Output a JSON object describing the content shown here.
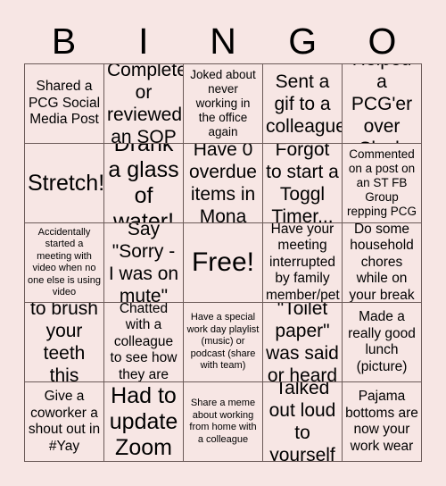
{
  "card": {
    "title": "BINGO",
    "background_color": "#f7e6e4",
    "border_color": "#6b5a58",
    "text_color": "#000000",
    "header_letters": [
      "B",
      "I",
      "N",
      "G",
      "O"
    ],
    "columns": 5,
    "rows": 5,
    "cells": [
      {
        "text": "Shared a PCG Social Media Post",
        "size": "s-md"
      },
      {
        "text": "Completed or reviewed an SOP",
        "size": "s-lg"
      },
      {
        "text": "Joked about never working in the office again",
        "size": "s-sm"
      },
      {
        "text": "Sent a gif to a colleague",
        "size": "s-lg"
      },
      {
        "text": "Helped a PCG'er over Slack",
        "size": "s-lg"
      },
      {
        "text": "Stretch!",
        "size": "s-xl"
      },
      {
        "text": "Drank a glass of water!",
        "size": "s-xl"
      },
      {
        "text": "Have 0 overdue items in Mona",
        "size": "s-lg"
      },
      {
        "text": "Forgot to start a Toggl Timer...",
        "size": "s-lg"
      },
      {
        "text": "Commented on a post on an ST FB Group repping PCG",
        "size": "s-sm"
      },
      {
        "text": "Accidentally started a meeting with video when no one else is using video",
        "size": "s-xs"
      },
      {
        "text": "Say \"Sorry - I was on mute\"",
        "size": "s-lg"
      },
      {
        "text": "Free!",
        "size": "s-free"
      },
      {
        "text": "Have your meeting interrupted by family member/pet",
        "size": "s-md"
      },
      {
        "text": "Do some household chores while on your break",
        "size": "s-md"
      },
      {
        "text": "Forgot to brush your teeth this morning",
        "size": "s-lg"
      },
      {
        "text": "Chatted with a colleague to see how they are",
        "size": "s-md"
      },
      {
        "text": "Have a special work day playlist (music) or podcast (share with team)",
        "size": "s-xs"
      },
      {
        "text": "\"Toilet paper\" was said or heard",
        "size": "s-lg"
      },
      {
        "text": "Made a really good lunch (picture)",
        "size": "s-md"
      },
      {
        "text": "Give a coworker a shout out in #Yay",
        "size": "s-md"
      },
      {
        "text": "Had to update Zoom",
        "size": "s-xl"
      },
      {
        "text": "Share a meme about working from home with a colleague",
        "size": "s-xs"
      },
      {
        "text": "Talked out loud to yourself",
        "size": "s-lg"
      },
      {
        "text": "Pajama bottoms are now your work wear",
        "size": "s-md"
      }
    ]
  }
}
